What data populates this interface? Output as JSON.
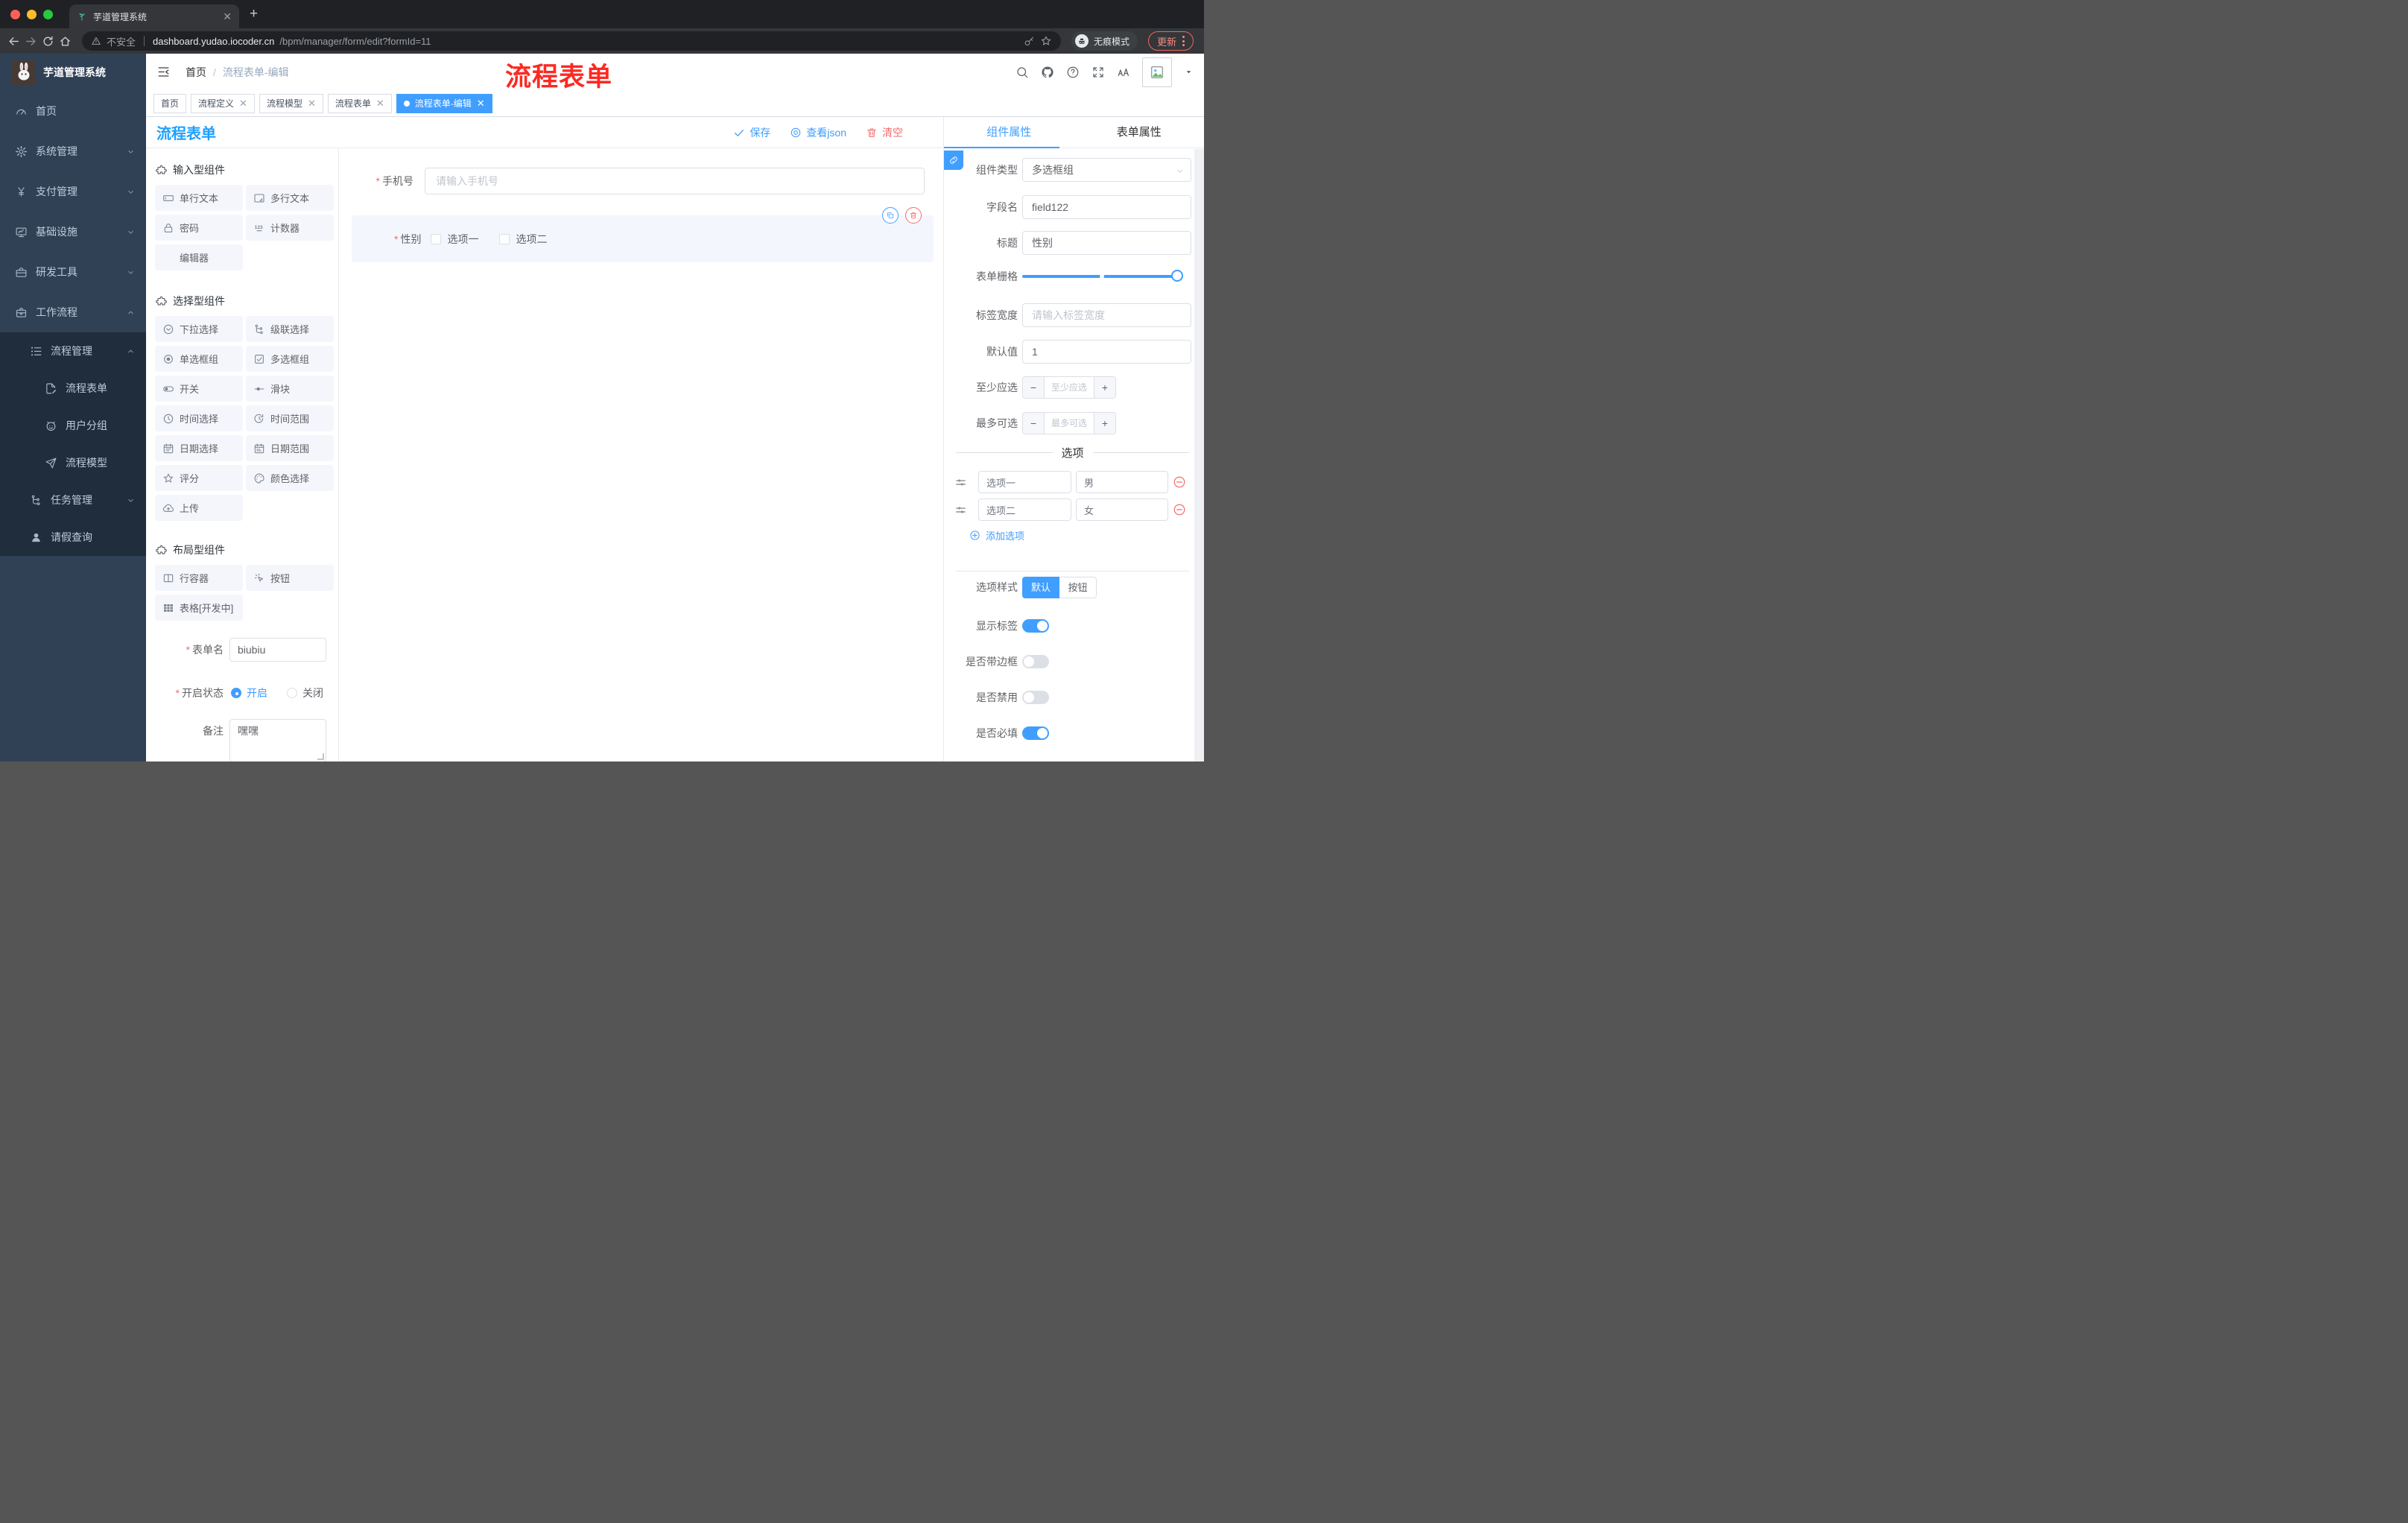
{
  "browser": {
    "tab_title": "芋道管理系统",
    "security_label": "不安全",
    "url_host": "dashboard.yudao.iocoder.cn",
    "url_path": "/bpm/manager/form/edit?formId=11",
    "incognito_label": "无痕模式",
    "update_label": "更新"
  },
  "sidebar": {
    "brand": "芋道管理系统",
    "items": [
      {
        "label": "首页",
        "icon": "dashboard-icon"
      },
      {
        "label": "系统管理",
        "icon": "gear-icon"
      },
      {
        "label": "支付管理",
        "icon": "yen-icon"
      },
      {
        "label": "基础设施",
        "icon": "monitor-icon"
      },
      {
        "label": "研发工具",
        "icon": "toolbox-icon"
      },
      {
        "label": "工作流程",
        "icon": "briefcase-icon"
      },
      {
        "label": "流程管理",
        "icon": "list-icon"
      },
      {
        "label": "流程表单",
        "icon": "form-doc-icon"
      },
      {
        "label": "用户分组",
        "icon": "user-group-icon"
      },
      {
        "label": "流程模型",
        "icon": "paper-plane-icon"
      },
      {
        "label": "任务管理",
        "icon": "tree-icon"
      },
      {
        "label": "请假查询",
        "icon": "person-icon"
      }
    ]
  },
  "header": {
    "breadcrumb_home": "首页",
    "breadcrumb_current": "流程表单-编辑",
    "annotation": "流程表单"
  },
  "tags": [
    {
      "label": "首页"
    },
    {
      "label": "流程定义"
    },
    {
      "label": "流程模型"
    },
    {
      "label": "流程表单"
    },
    {
      "label": "流程表单-编辑"
    }
  ],
  "builder": {
    "title": "流程表单",
    "save_label": "保存",
    "view_json_label": "查看json",
    "clear_label": "清空",
    "sections": [
      {
        "title": "输入型组件",
        "items": [
          {
            "label": "单行文本",
            "icon": "input-icon"
          },
          {
            "label": "多行文本",
            "icon": "textarea-icon"
          },
          {
            "label": "密码",
            "icon": "lock-icon"
          },
          {
            "label": "计数器",
            "icon": "counter-icon"
          },
          {
            "label": "编辑器",
            "icon": ""
          }
        ]
      },
      {
        "title": "选择型组件",
        "items": [
          {
            "label": "下拉选择",
            "icon": "select-icon"
          },
          {
            "label": "级联选择",
            "icon": "cascade-icon"
          },
          {
            "label": "单选框组",
            "icon": "radio-icon"
          },
          {
            "label": "多选框组",
            "icon": "checkbox-icon"
          },
          {
            "label": "开关",
            "icon": "switch-icon"
          },
          {
            "label": "滑块",
            "icon": "slider-icon"
          },
          {
            "label": "时间选择",
            "icon": "clock-icon"
          },
          {
            "label": "时间范围",
            "icon": "time-range-icon"
          },
          {
            "label": "日期选择",
            "icon": "calendar-icon"
          },
          {
            "label": "日期范围",
            "icon": "date-range-icon"
          },
          {
            "label": "评分",
            "icon": "star-icon"
          },
          {
            "label": "颜色选择",
            "icon": "palette-icon"
          },
          {
            "label": "上传",
            "icon": "upload-cloud-icon"
          }
        ]
      },
      {
        "title": "布局型组件",
        "items": [
          {
            "label": "行容器",
            "icon": "columns-icon"
          },
          {
            "label": "按钮",
            "icon": "click-icon"
          },
          {
            "label": "表格[开发中]",
            "icon": "table-icon"
          }
        ]
      }
    ],
    "form_name_label": "表单名",
    "form_name_value": "biubiu",
    "status_label": "开启状态",
    "status_on": "开启",
    "status_off": "关闭",
    "remark_label": "备注",
    "remark_value": "嘿嘿"
  },
  "canvas": {
    "phone_label": "手机号",
    "phone_placeholder": "请输入手机号",
    "gender_label": "性别",
    "gender_option1": "选项一",
    "gender_option2": "选项二"
  },
  "inspector": {
    "tab_component": "组件属性",
    "tab_form": "表单属性",
    "component_type_label": "组件类型",
    "component_type_value": "多选框组",
    "field_name_label": "字段名",
    "field_name_value": "field122",
    "title_label": "标题",
    "title_value": "性别",
    "grid_label": "表单栅格",
    "label_width_label": "标签宽度",
    "label_width_placeholder": "请输入标签宽度",
    "default_label": "默认值",
    "default_value": "1",
    "min_label": "至少应选",
    "min_placeholder": "至少应选",
    "max_label": "最多可选",
    "max_placeholder": "最多可选",
    "options_title": "选项",
    "option_rows": [
      {
        "label": "选项一",
        "value": "男"
      },
      {
        "label": "选项二",
        "value": "女"
      }
    ],
    "add_option_label": "添加选项",
    "style_label": "选项样式",
    "style_default": "默认",
    "style_button": "按钮",
    "switches": [
      {
        "label": "显示标签",
        "on": true
      },
      {
        "label": "是否带边框",
        "on": false
      },
      {
        "label": "是否禁用",
        "on": false
      },
      {
        "label": "是否必填",
        "on": true
      }
    ]
  },
  "colors": {
    "accent": "#409eff",
    "danger": "#f56c6c",
    "title_blue": "#1e9fff",
    "annotation_red": "#fb2a23",
    "sidebar_bg": "#304156",
    "sidebar_sub_bg": "#1f2d3d",
    "chrome_bg": "#202124"
  }
}
